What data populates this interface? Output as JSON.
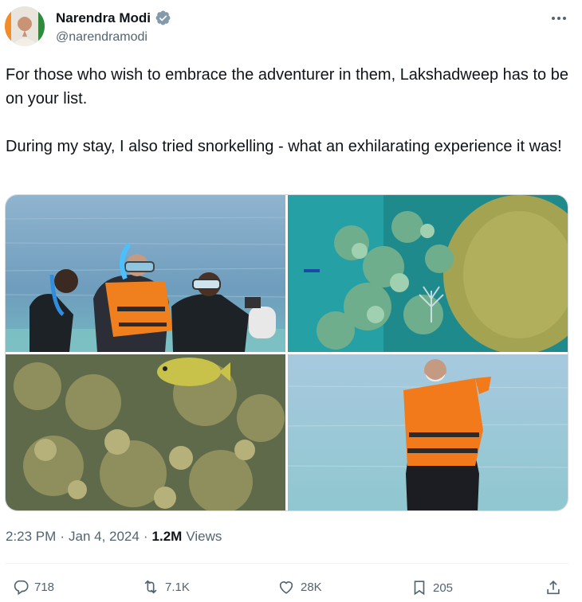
{
  "author": {
    "name": "Narendra Modi",
    "handle": "@narendramodi",
    "verified": true
  },
  "tweet": {
    "paragraph1": "For those who wish to embrace the adventurer in them, Lakshadweep has to be on your list.",
    "paragraph2": "During my stay, I also tried snorkelling - what an exhilarating experience it was!"
  },
  "meta": {
    "time": "2:23 PM",
    "separator": "·",
    "date": "Jan 4, 2024",
    "views_count": "1.2M",
    "views_label": "Views"
  },
  "actions": {
    "replies": "718",
    "reposts": "7.1K",
    "likes": "28K",
    "bookmarks": "205"
  },
  "colors": {
    "text": "#0f1419",
    "secondary": "#536471",
    "verified_badge": "#829aab",
    "divider": "#eff3f4"
  },
  "icons": {
    "more": "more-horizontal-icon",
    "verified": "verified-badge-icon",
    "reply": "reply-icon",
    "repost": "repost-icon",
    "like": "heart-icon",
    "bookmark": "bookmark-icon",
    "share": "share-icon"
  }
}
